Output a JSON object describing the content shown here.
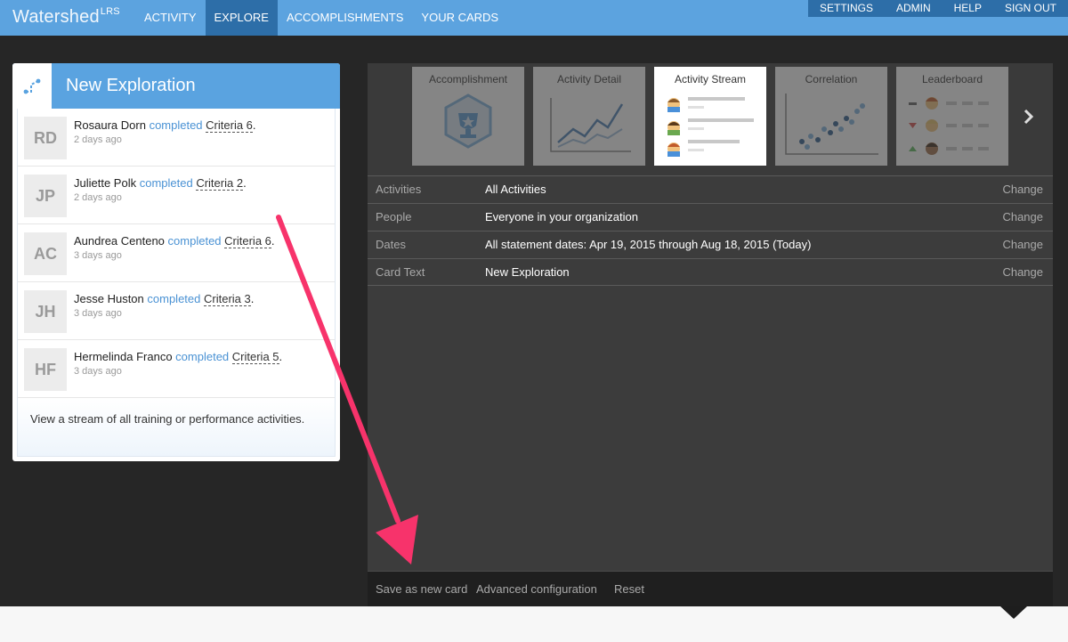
{
  "brand": {
    "name": "Watershed",
    "suffix": "LRS"
  },
  "nav": [
    {
      "label": "ACTIVITY",
      "active": false
    },
    {
      "label": "EXPLORE",
      "active": true
    },
    {
      "label": "ACCOMPLISHMENTS",
      "active": false
    },
    {
      "label": "YOUR CARDS",
      "active": false
    }
  ],
  "system_nav": [
    "SETTINGS",
    "ADMIN",
    "HELP",
    "SIGN OUT"
  ],
  "card": {
    "title": "New Exploration",
    "icon": "explore-flow-icon",
    "description": "View a stream of all training or performance activities.",
    "stream": [
      {
        "initials": "RD",
        "name": "Rosaura Dorn",
        "verb": "completed",
        "object": "Criteria 6",
        "punct": ".",
        "time": "2 days ago"
      },
      {
        "initials": "JP",
        "name": "Juliette Polk",
        "verb": "completed",
        "object": "Criteria 2",
        "punct": ".",
        "time": "2 days ago"
      },
      {
        "initials": "AC",
        "name": "Aundrea Centeno",
        "verb": "completed",
        "object": "Criteria 6",
        "punct": ".",
        "time": "3 days ago"
      },
      {
        "initials": "JH",
        "name": "Jesse Huston",
        "verb": "completed",
        "object": "Criteria 3",
        "punct": ".",
        "time": "3 days ago"
      },
      {
        "initials": "HF",
        "name": "Hermelinda Franco",
        "verb": "completed",
        "object": "Criteria 5",
        "punct": ".",
        "time": "3 days ago"
      }
    ]
  },
  "report_types": [
    {
      "label": "Accomplishment",
      "icon": "trophy-hex-icon",
      "active": false
    },
    {
      "label": "Activity Detail",
      "icon": "line-chart-icon",
      "active": false
    },
    {
      "label": "Activity Stream",
      "icon": "activity-stream-icon",
      "active": true
    },
    {
      "label": "Correlation",
      "icon": "scatter-plot-icon",
      "active": false
    },
    {
      "label": "Leaderboard",
      "icon": "leaderboard-icon",
      "active": false
    }
  ],
  "carousel_next_icon": "chevron-right-icon",
  "settings": [
    {
      "label": "Activities",
      "value": "All Activities",
      "action": "Change"
    },
    {
      "label": "People",
      "value": "Everyone in your organization",
      "action": "Change"
    },
    {
      "label": "Dates",
      "value": "All statement dates: Apr 19, 2015 through Aug 18, 2015 (Today)",
      "action": "Change"
    },
    {
      "label": "Card Text",
      "value": "New Exploration",
      "action": "Change"
    }
  ],
  "footer": {
    "save": "Save as new card",
    "advanced": "Advanced configuration",
    "reset": "Reset"
  },
  "colors": {
    "topbar": "#5ca3df",
    "nav_active": "#2d6ea8",
    "verb": "#4a92d4",
    "annotation": "#f7336b"
  }
}
